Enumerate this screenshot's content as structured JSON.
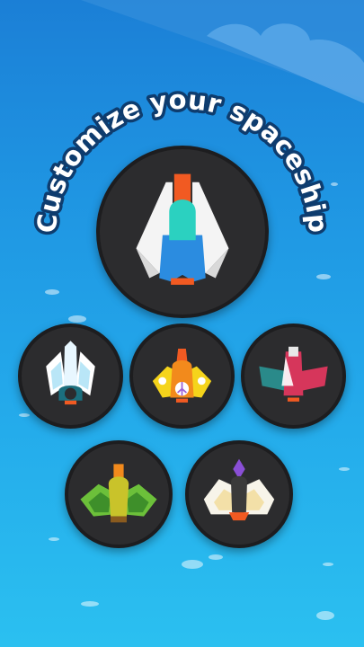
{
  "screen": {
    "title": "Customize your spaceship",
    "background_color": "#1f95e2",
    "accent_color": "#f15a22"
  },
  "ships": [
    {
      "name": "classic-white-ship",
      "selected": true
    },
    {
      "name": "crystal-ship"
    },
    {
      "name": "flower-peace-ship"
    },
    {
      "name": "red-winged-ship"
    },
    {
      "name": "green-leaf-ship"
    },
    {
      "name": "moth-ship"
    }
  ]
}
